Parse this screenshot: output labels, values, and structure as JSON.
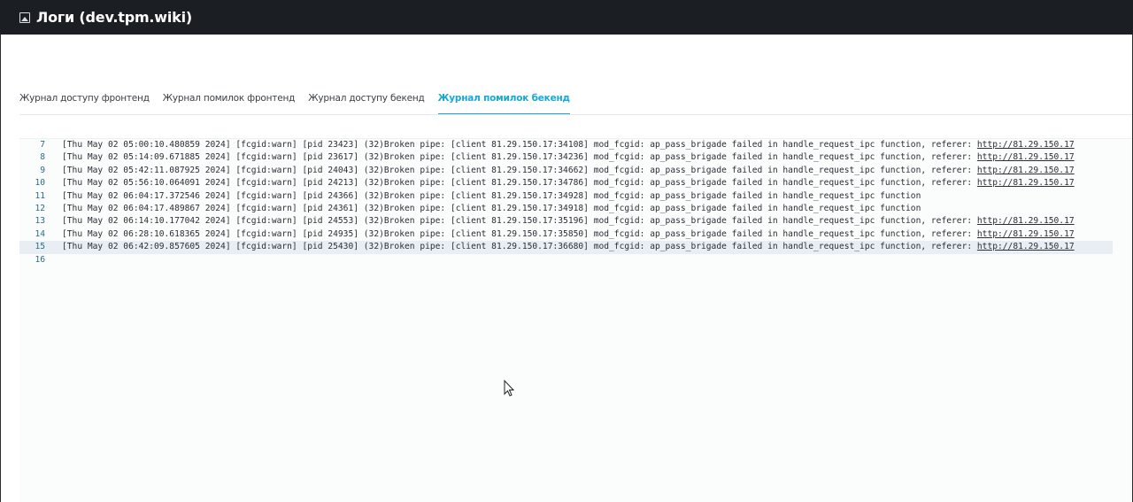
{
  "window": {
    "title": "Логи (dev.tpm.wiki)"
  },
  "tabs": [
    {
      "label": "Журнал доступу фронтенд",
      "active": false
    },
    {
      "label": "Журнал помилок фронтенд",
      "active": false
    },
    {
      "label": "Журнал доступу бекенд",
      "active": false
    },
    {
      "label": "Журнал помилок бекенд",
      "active": true
    }
  ],
  "log": {
    "lines": [
      {
        "num": "7",
        "text": "[Thu May 02 05:00:10.480859 2024] [fcgid:warn] [pid 23423] (32)Broken pipe: [client 81.29.150.17:34108] mod_fcgid: ap_pass_brigade failed in handle_request_ipc function, referer: ",
        "link": "http://81.29.150.17"
      },
      {
        "num": "8",
        "text": "[Thu May 02 05:14:09.671885 2024] [fcgid:warn] [pid 23617] (32)Broken pipe: [client 81.29.150.17:34236] mod_fcgid: ap_pass_brigade failed in handle_request_ipc function, referer: ",
        "link": "http://81.29.150.17"
      },
      {
        "num": "9",
        "text": "[Thu May 02 05:42:11.087925 2024] [fcgid:warn] [pid 24043] (32)Broken pipe: [client 81.29.150.17:34662] mod_fcgid: ap_pass_brigade failed in handle_request_ipc function, referer: ",
        "link": "http://81.29.150.17"
      },
      {
        "num": "10",
        "text": "[Thu May 02 05:56:10.064091 2024] [fcgid:warn] [pid 24213] (32)Broken pipe: [client 81.29.150.17:34786] mod_fcgid: ap_pass_brigade failed in handle_request_ipc function, referer: ",
        "link": "http://81.29.150.17"
      },
      {
        "num": "11",
        "text": "[Thu May 02 06:04:17.372546 2024] [fcgid:warn] [pid 24366] (32)Broken pipe: [client 81.29.150.17:34928] mod_fcgid: ap_pass_brigade failed in handle_request_ipc function",
        "link": ""
      },
      {
        "num": "12",
        "text": "[Thu May 02 06:04:17.489867 2024] [fcgid:warn] [pid 24361] (32)Broken pipe: [client 81.29.150.17:34918] mod_fcgid: ap_pass_brigade failed in handle_request_ipc function",
        "link": ""
      },
      {
        "num": "13",
        "text": "[Thu May 02 06:14:10.177042 2024] [fcgid:warn] [pid 24553] (32)Broken pipe: [client 81.29.150.17:35196] mod_fcgid: ap_pass_brigade failed in handle_request_ipc function, referer: ",
        "link": "http://81.29.150.17"
      },
      {
        "num": "14",
        "text": "[Thu May 02 06:28:10.618365 2024] [fcgid:warn] [pid 24935] (32)Broken pipe: [client 81.29.150.17:35850] mod_fcgid: ap_pass_brigade failed in handle_request_ipc function, referer: ",
        "link": "http://81.29.150.17"
      },
      {
        "num": "15",
        "text": "[Thu May 02 06:42:09.857605 2024] [fcgid:warn] [pid 25430] (32)Broken pipe: [client 81.29.150.17:36680] mod_fcgid: ap_pass_brigade failed in handle_request_ipc function, referer: ",
        "link": "http://81.29.150.17"
      },
      {
        "num": "16",
        "text": "",
        "link": ""
      }
    ]
  }
}
